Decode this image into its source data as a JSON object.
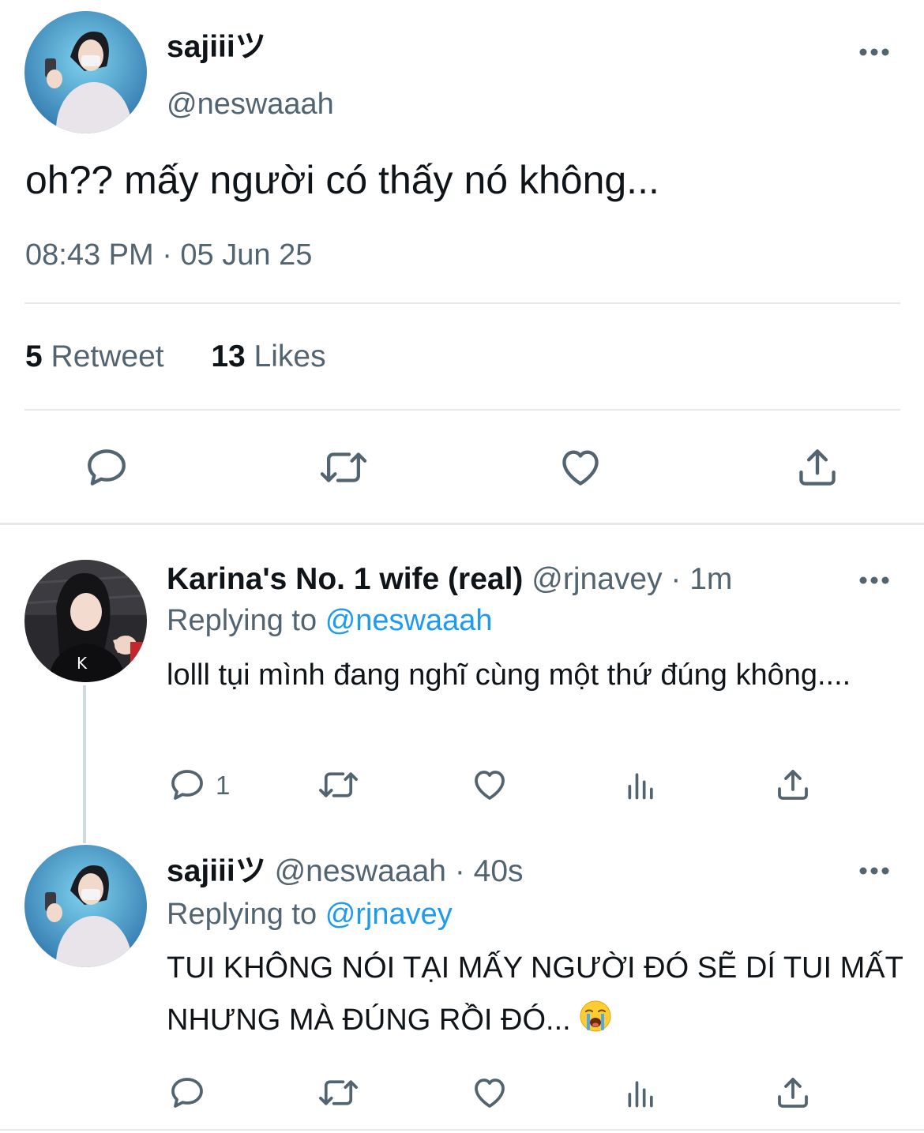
{
  "main_tweet": {
    "author_name": "sajiiiツ",
    "author_handle": "@neswaaah",
    "text": "oh?? mấy người có thấy nó không...",
    "timestamp": "08:43 PM · 05 Jun 25",
    "retweet_count": "5",
    "retweet_label": "Retweet",
    "likes_count": "13",
    "likes_label": "Likes",
    "actions": [
      "reply-icon",
      "retweet-icon",
      "like-icon",
      "share-icon"
    ]
  },
  "replies": [
    {
      "author_name": "Karina's No. 1 wife (real)",
      "author_handle": "@rjnavey",
      "time": "· 1m",
      "replying_label": "Replying to",
      "replying_to": "@neswaaah",
      "text": "lolll tụi mình đang nghĩ cùng một thứ đúng không....",
      "reply_count": "1",
      "actions": [
        "reply-icon",
        "retweet-icon",
        "like-icon",
        "analytics-icon",
        "share-icon"
      ]
    },
    {
      "author_name": "sajiiiツ",
      "author_handle": "@neswaaah",
      "time": "· 40s",
      "replying_label": "Replying to",
      "replying_to": "@rjnavey",
      "text": "TUI KHÔNG NÓI TẠI MẤY NGƯỜI ĐÓ SẼ DÍ TUI MẤT NHƯNG MÀ ĐÚNG RỒI ĐÓ...",
      "emoji": "loudly-crying-face",
      "actions": [
        "reply-icon",
        "retweet-icon",
        "like-icon",
        "analytics-icon",
        "share-icon"
      ]
    }
  ],
  "colors": {
    "text": "#0f1419",
    "secondary": "#536471",
    "link": "#1d9bf0",
    "divider": "#e6e9ec",
    "icon": "#536471"
  }
}
